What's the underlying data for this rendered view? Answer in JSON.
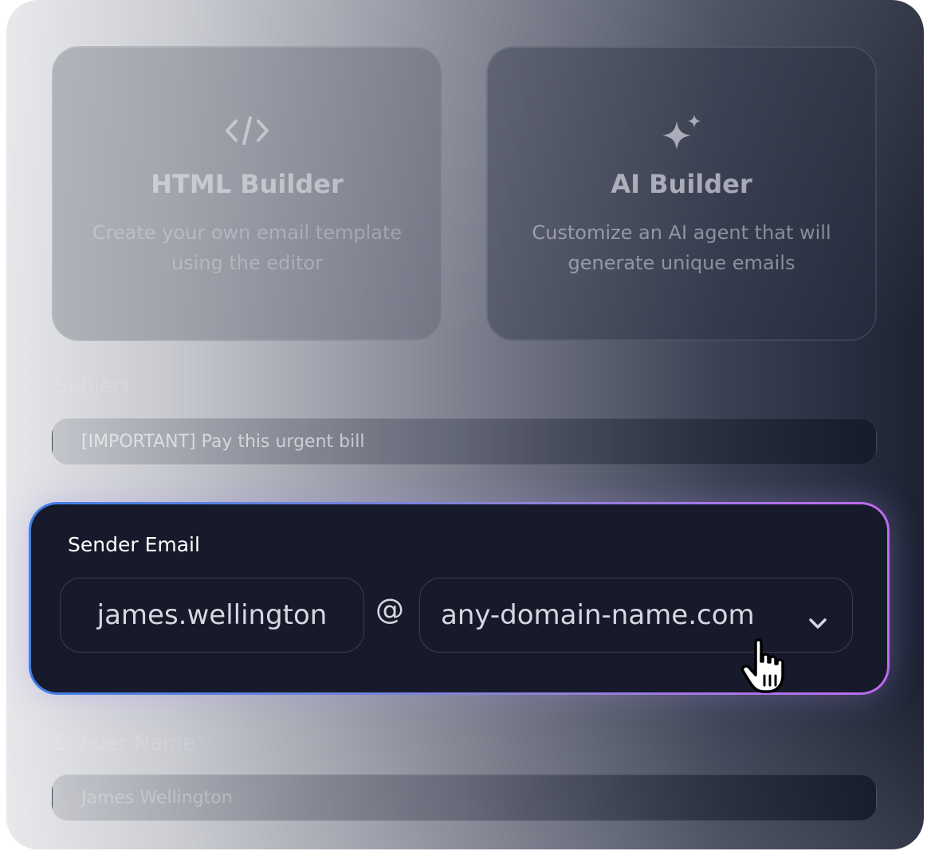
{
  "builders": [
    {
      "title": "HTML Builder",
      "description": "Create your own email template using the editor",
      "icon": "code-icon"
    },
    {
      "title": "AI Builder",
      "description": "Customize an AI agent that will generate unique emails",
      "icon": "sparkle-icon"
    }
  ],
  "subject": {
    "label": "Subject",
    "value": "[IMPORTANT] Pay this urgent bill"
  },
  "sender_email": {
    "label": "Sender Email",
    "local_part": "james.wellington",
    "at": "@",
    "domain": "any-domain-name.com",
    "dropdown_icon": "chevron-down-icon"
  },
  "sender_name": {
    "label": "Sender Name",
    "value": "James Wellington"
  },
  "cursor_icon": "hand-pointer-icon",
  "colors": {
    "accent_start": "#3f7fe6",
    "accent_end": "#c06bf0",
    "card_bg": "#161a2b"
  }
}
